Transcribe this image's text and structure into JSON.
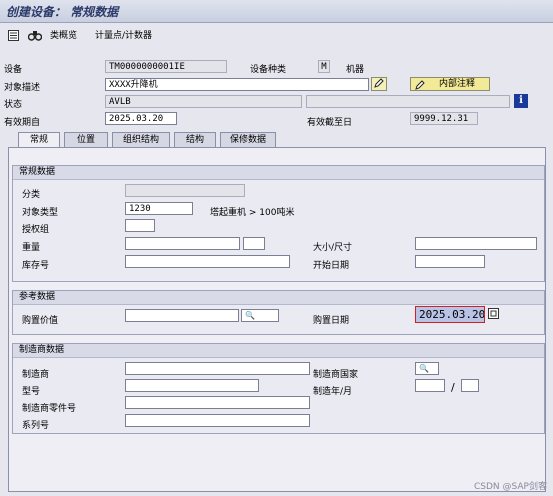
{
  "title": "创建设备： 常规数据",
  "toolbar": {
    "classification_label": "类概览",
    "measuring_label": "计量点/计数器"
  },
  "header": {
    "equipment_label": "设备",
    "equipment_value": "TM0000000001IE",
    "category_label": "设备种类",
    "category_code": "M",
    "category_text": "机器",
    "description_label": "对象描述",
    "description_value": "XXXX升降机",
    "internal_note_label": "内部注释",
    "status_label": "状态",
    "status_value": "AVLB",
    "valid_from_label": "有效期自",
    "valid_from_value": "2025.03.20",
    "valid_to_label": "有效截至日",
    "valid_to_value": "9999.12.31"
  },
  "tabs": [
    "常规",
    "位置",
    "组织结构",
    "结构",
    "保修数据"
  ],
  "general_data": {
    "title": "常规数据",
    "class_label": "分类",
    "class_value": "",
    "object_type_label": "对象类型",
    "object_type_value": "1230",
    "object_type_text": "塔起重机 > 100吨米",
    "auth_group_label": "授权组",
    "auth_group_value": "",
    "weight_label": "重量",
    "weight_value": "",
    "weight_unit": "",
    "size_label": "大小/尺寸",
    "size_value": "",
    "inventory_label": "库存号",
    "inventory_value": "",
    "start_date_label": "开始日期",
    "start_date_value": ""
  },
  "reference_data": {
    "title": "参考数据",
    "acq_value_label": "购置价值",
    "acq_value_value": "",
    "acq_currency": "",
    "acq_date_label": "购置日期",
    "acq_date_value": "2025.03.20"
  },
  "manufacturer_data": {
    "title": "制造商数据",
    "manufacturer_label": "制造商",
    "manufacturer_value": "",
    "country_label": "制造商国家",
    "country_value": "",
    "model_label": "型号",
    "model_value": "",
    "year_month_label": "制造年/月",
    "year_value": "",
    "month_value": "",
    "separator": "/",
    "part_no_label": "制造商零件号",
    "part_no_value": "",
    "serial_label": "系列号",
    "serial_value": ""
  },
  "watermark": "CSDN @SAP剑客"
}
